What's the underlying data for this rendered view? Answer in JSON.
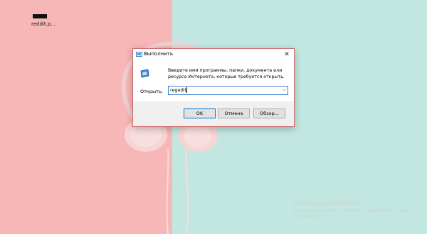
{
  "desktop": {
    "icon_label": "reddit.p...",
    "icon_name": "shortcut-file-icon"
  },
  "dialog": {
    "title": "Выполнить",
    "title_icon": "run-icon",
    "close_icon": "close-icon",
    "description": "Введите имя программы, папки, документа или ресурса Интернета, которые требуется открыть.",
    "open_label": "Открыть:",
    "open_value": "regedit",
    "dropdown_icon": "chevron-down-icon",
    "buttons": {
      "ok": "OK",
      "cancel": "Отмена",
      "browse": "Обзор..."
    },
    "accent_color": "#0078d7",
    "border_color": "#d06a6a"
  },
  "watermark": {
    "title": "Активация Windows",
    "text": "Чтобы активировать Windows, перейдите в раздел \"Параметры\"."
  },
  "colors": {
    "wall_left": "#f6b7b6",
    "wall_right": "#c2e7e0"
  }
}
